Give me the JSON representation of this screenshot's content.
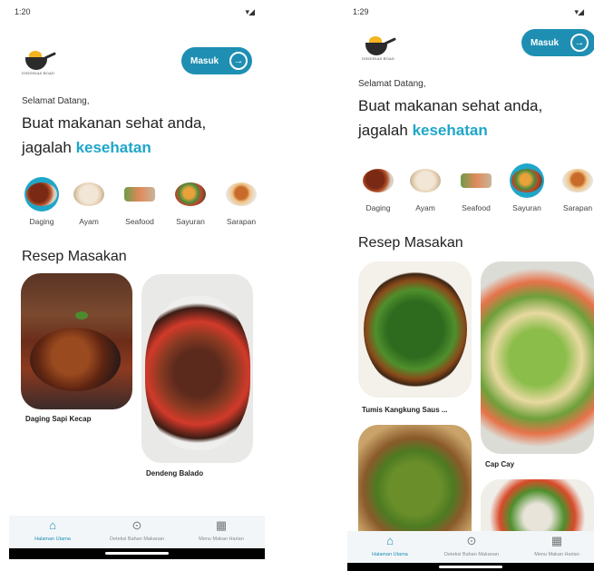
{
  "colors": {
    "accent": "#1fa6c9",
    "button": "#1e8fb3",
    "nav_bg": "#f2f6f9"
  },
  "left": {
    "status_time": "1:20",
    "logo_text": "DINDINAS ROAD",
    "masuk_label": "Masuk",
    "greeting": "Selamat Datang,",
    "headline_1": "Buat makanan sehat anda,",
    "headline_2_prefix": "jagalah ",
    "headline_2_accent": "kesehatan",
    "categories": [
      {
        "label": "Daging",
        "selected": true
      },
      {
        "label": "Ayam",
        "selected": false
      },
      {
        "label": "Seafood",
        "selected": false
      },
      {
        "label": "Sayuran",
        "selected": false
      },
      {
        "label": "Sarapan",
        "selected": false
      }
    ],
    "section_title": "Resep Masakan",
    "recipes": [
      "Daging Sapi Kecap",
      "Dendeng Balado"
    ],
    "nav": [
      {
        "label": "Halaman Utama",
        "icon": "home-icon",
        "active": true
      },
      {
        "label": "Deteksi Bahan Makanan",
        "icon": "scan-icon",
        "active": false
      },
      {
        "label": "Menu Makan Harian",
        "icon": "calendar-icon",
        "active": false
      }
    ]
  },
  "right": {
    "status_time": "1:29",
    "logo_text": "DINDINAS ROAD",
    "masuk_label": "Masuk",
    "greeting": "Selamat Datang,",
    "headline_1": "Buat makanan sehat anda,",
    "headline_2_prefix": "jagalah ",
    "headline_2_accent": "kesehatan",
    "categories": [
      {
        "label": "Daging",
        "selected": false
      },
      {
        "label": "Ayam",
        "selected": false
      },
      {
        "label": "Seafood",
        "selected": false
      },
      {
        "label": "Sayuran",
        "selected": true
      },
      {
        "label": "Sarapan",
        "selected": false
      }
    ],
    "section_title": "Resep Masakan",
    "recipes": [
      "Tumis Kangkung Saus ...",
      "Cap Cay"
    ],
    "nav": [
      {
        "label": "Halaman Utama",
        "icon": "home-icon",
        "active": true
      },
      {
        "label": "Deteksi Bahan Makanan",
        "icon": "scan-icon",
        "active": false
      },
      {
        "label": "Menu Makan Harian",
        "icon": "calendar-icon",
        "active": false
      }
    ]
  }
}
